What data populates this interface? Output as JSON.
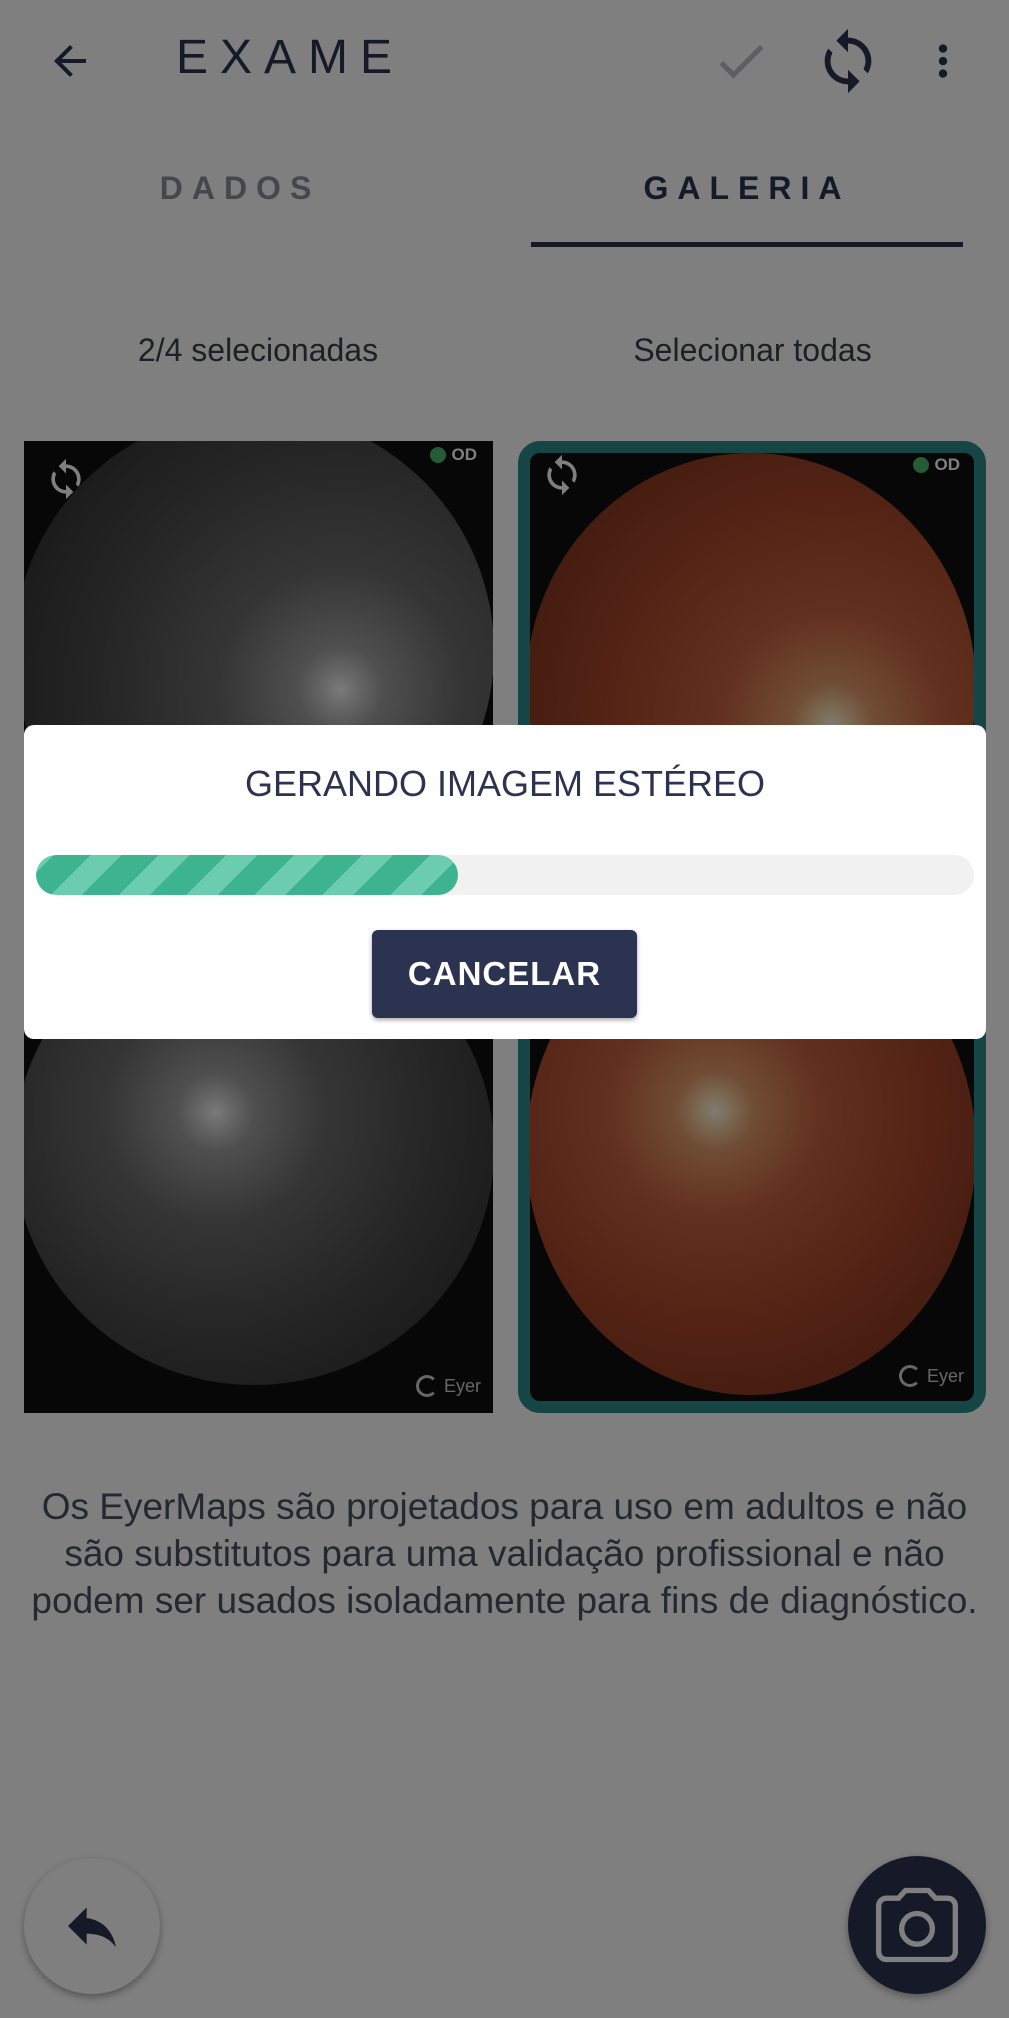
{
  "header": {
    "title": "EXAME",
    "back_icon": "arrow-left-icon",
    "confirm_icon": "check-icon",
    "sync_icon": "sync-icon",
    "more_icon": "more-vert-icon"
  },
  "tabs": [
    {
      "label": "DADOS",
      "active": false
    },
    {
      "label": "GALERIA",
      "active": true
    }
  ],
  "gallery": {
    "selection_count": "2/4 selecionadas",
    "select_all_label": "Selecionar todas",
    "images": [
      {
        "eye": "OD",
        "type": "red-free",
        "selected": false,
        "watermark": ""
      },
      {
        "eye": "OD",
        "type": "color",
        "selected": true,
        "watermark": ""
      },
      {
        "eye": "",
        "type": "red-free",
        "selected": false,
        "watermark": "Eyer"
      },
      {
        "eye": "",
        "type": "color",
        "selected": true,
        "watermark": "Eyer"
      }
    ]
  },
  "disclaimer": "Os EyerMaps são projetados para uso em adultos e não são substitutos para uma validação profissional e não podem ser usados isoladamente para fins de diagnóstico.",
  "fab": {
    "undo_icon": "reply-icon",
    "camera_icon": "camera-icon"
  },
  "dialog": {
    "title": "GERANDO IMAGEM ESTÉREO",
    "progress": 0.45,
    "cancel_label": "CANCELAR"
  },
  "colors": {
    "primary": "#2c3350",
    "accent_teal": "#2a8a8a",
    "progress": "#3db38f",
    "od_badge": "#4cb86a"
  }
}
